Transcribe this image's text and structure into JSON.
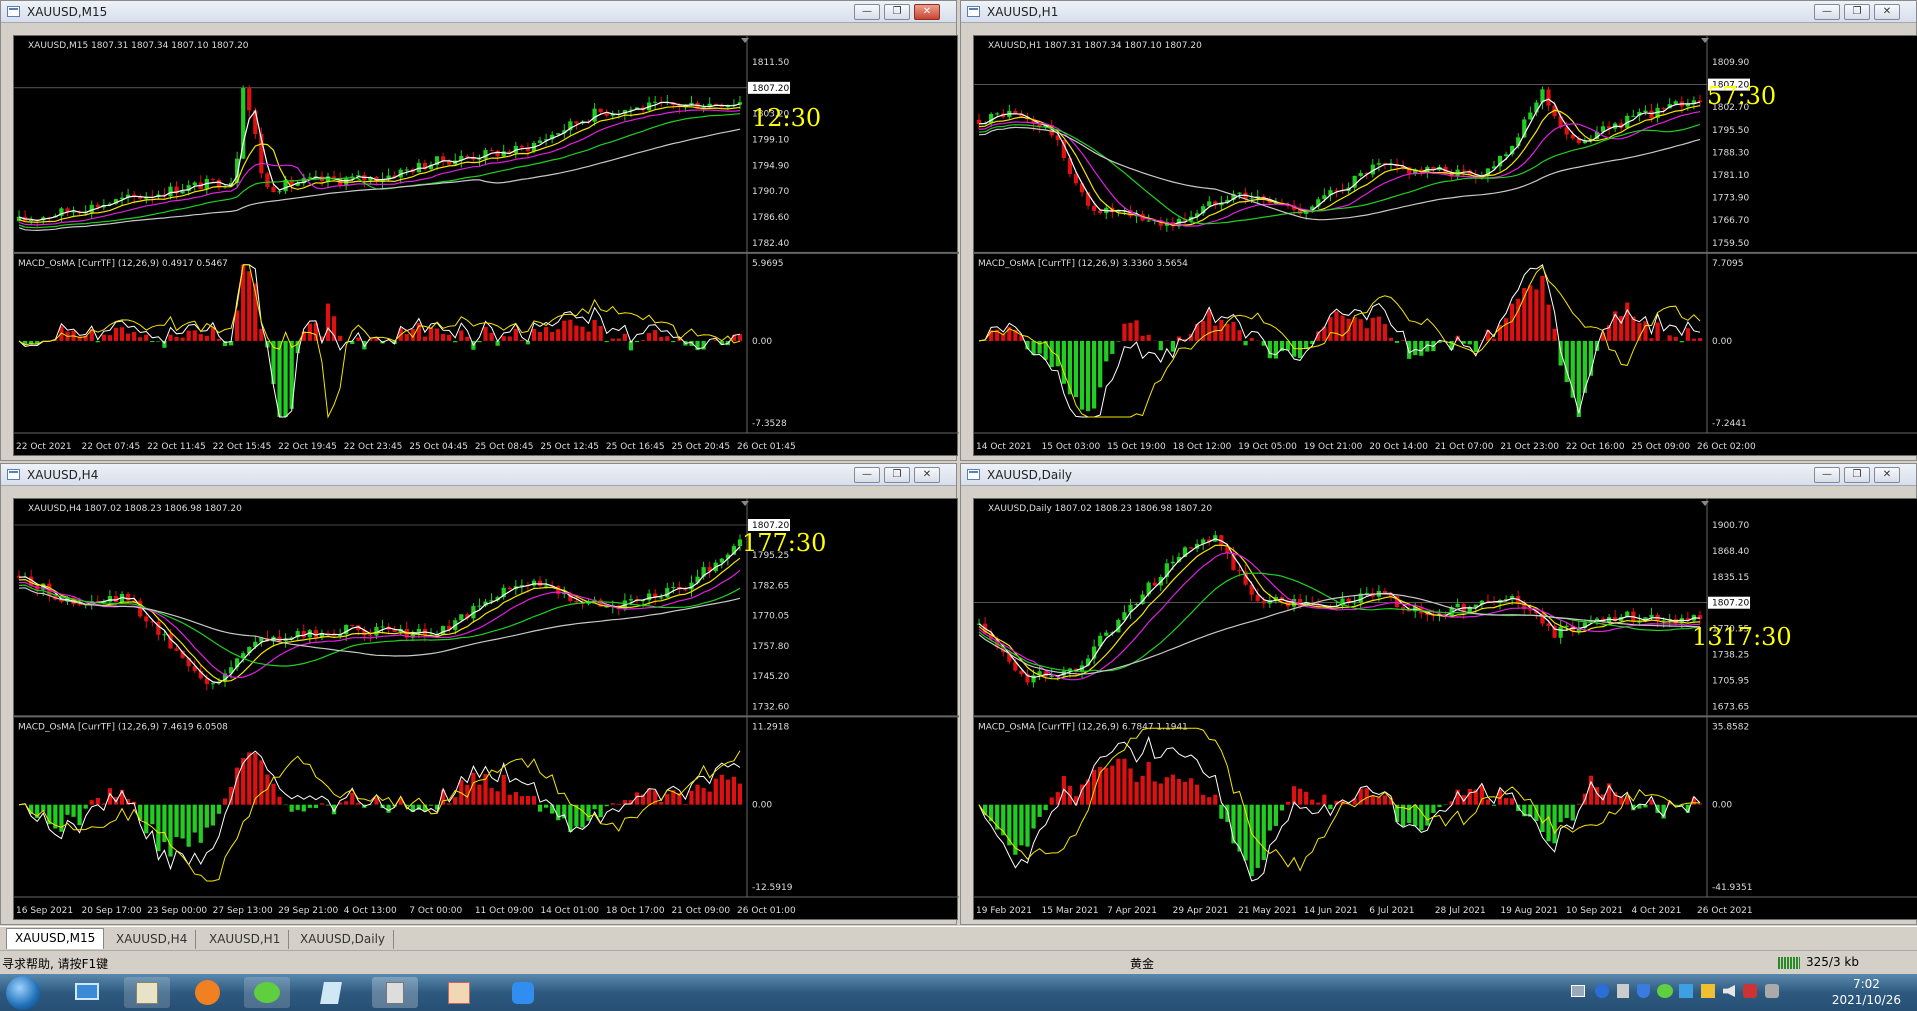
{
  "colors": {
    "bg": "#000000",
    "bull": "#22cc22",
    "bear": "#dd1111",
    "ma_white": "#ffffff",
    "ma_yellow": "#f5e600",
    "ma_magenta": "#e020e0",
    "ma_green": "#20d020",
    "ma_gray": "#c8c8c8",
    "timer": "#ffff00"
  },
  "windows": [
    {
      "id": "m15",
      "title": "XAUUSD,M15",
      "header": "XAUUSD,M15  1807.31 1807.34 1807.10 1807.20",
      "timer": "12:30",
      "current_price": "1807.20",
      "price_ticks": [
        "1811.50",
        "1807.20",
        "1803.20",
        "1799.10",
        "1794.90",
        "1790.70",
        "1786.60",
        "1782.40"
      ],
      "macd_header": "MACD_OsMA [CurrTF] (12,26,9) 0.4917 0.5467",
      "macd_ticks": [
        "5.9695",
        "0.00",
        "-7.3528"
      ],
      "time_labels": [
        "22 Oct 2021",
        "22 Oct 07:45",
        "22 Oct 11:45",
        "22 Oct 15:45",
        "22 Oct 19:45",
        "22 Oct 23:45",
        "25 Oct 04:45",
        "25 Oct 08:45",
        "25 Oct 12:45",
        "25 Oct 16:45",
        "25 Oct 20:45",
        "26 Oct 01:45"
      ]
    },
    {
      "id": "h1",
      "title": "XAUUSD,H1",
      "header": "XAUUSD,H1  1807.31 1807.34 1807.10 1807.20",
      "timer": "57:30",
      "current_price": "1807.20",
      "price_ticks": [
        "1809.90",
        "1807.20",
        "1802.70",
        "1795.50",
        "1788.30",
        "1781.10",
        "1773.90",
        "1766.70",
        "1759.50"
      ],
      "macd_header": "MACD_OsMA [CurrTF] (12,26,9) 3.3360 3.5654",
      "macd_ticks": [
        "7.7095",
        "0.00",
        "-7.2441"
      ],
      "time_labels": [
        "14 Oct 2021",
        "15 Oct 03:00",
        "15 Oct 19:00",
        "18 Oct 12:00",
        "19 Oct 05:00",
        "19 Oct 21:00",
        "20 Oct 14:00",
        "21 Oct 07:00",
        "21 Oct 23:00",
        "22 Oct 16:00",
        "25 Oct 09:00",
        "26 Oct 02:00"
      ]
    },
    {
      "id": "h4",
      "title": "XAUUSD,H4",
      "header": "XAUUSD,H4  1807.02 1808.23 1806.98 1807.20",
      "timer": "177:30",
      "current_price": "1807.20",
      "price_ticks": [
        "1807.20",
        "1795.25",
        "1782.65",
        "1770.05",
        "1757.80",
        "1745.20",
        "1732.60"
      ],
      "macd_header": "MACD_OsMA [CurrTF] (12,26,9) 7.4619 6.0508",
      "macd_ticks": [
        "11.2918",
        "0.00",
        "-12.5919"
      ],
      "time_labels": [
        "16 Sep 2021",
        "20 Sep 17:00",
        "23 Sep 00:00",
        "27 Sep 13:00",
        "29 Sep 21:00",
        "4 Oct 13:00",
        "7 Oct 00:00",
        "11 Oct 09:00",
        "14 Oct 01:00",
        "18 Oct 17:00",
        "21 Oct 09:00",
        "26 Oct 01:00"
      ]
    },
    {
      "id": "d1",
      "title": "XAUUSD,Daily",
      "header": "XAUUSD,Daily  1807.02 1808.23 1806.98 1807.20",
      "timer": "1317:30",
      "current_price": "1807.20",
      "price_ticks": [
        "1900.70",
        "1868.40",
        "1835.15",
        "1807.20",
        "1770.55",
        "1738.25",
        "1705.95",
        "1673.65"
      ],
      "macd_header": "MACD_OsMA [CurrTF] (12,26,9) 6.7847 1.1941",
      "macd_ticks": [
        "35.8582",
        "0.00",
        "-41.9351"
      ],
      "time_labels": [
        "19 Feb 2021",
        "15 Mar 2021",
        "7 Apr 2021",
        "29 Apr 2021",
        "21 May 2021",
        "14 Jun 2021",
        "6 Jul 2021",
        "28 Jul 2021",
        "19 Aug 2021",
        "10 Sep 2021",
        "4 Oct 2021",
        "26 Oct 2021"
      ]
    }
  ],
  "tabs": [
    "XAUUSD,M15",
    "XAUUSD,H4",
    "XAUUSD,H1",
    "XAUUSD,Daily"
  ],
  "status": {
    "help": "寻求帮助, 请按F1键",
    "profile": "黄金",
    "traffic": "325/3 kb"
  },
  "taskbar": {
    "time": "7:02",
    "date": "2021/10/26"
  }
}
